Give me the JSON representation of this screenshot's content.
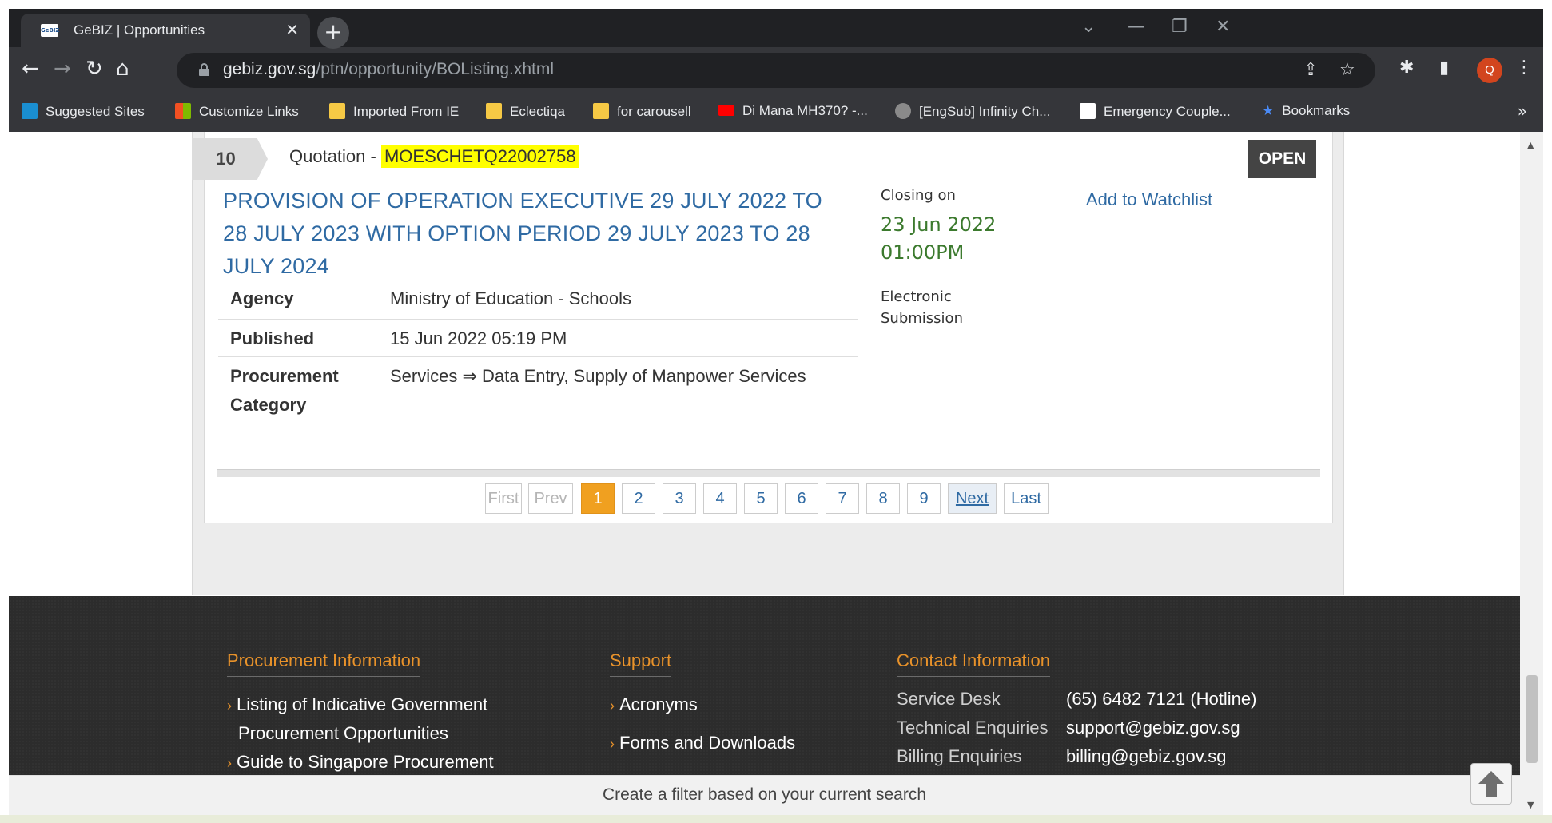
{
  "browser": {
    "tab_title": "GeBIZ | Opportunities",
    "tab_close": "✕",
    "new_tab": "+",
    "url_domain": "gebiz.gov.sg",
    "url_path": "/ptn/opportunity/BOListing.xhtml",
    "profile_initial": "Q",
    "bookmarks": [
      {
        "label": "Suggested Sites",
        "icon": "bing-icon",
        "color": "#1a8ed0"
      },
      {
        "label": "Customize Links",
        "icon": "windows-icon",
        "color": "#f25022"
      },
      {
        "label": "Imported From IE",
        "icon": "folder-icon",
        "color": "#f6c945"
      },
      {
        "label": "Eclectiqa",
        "icon": "folder-icon",
        "color": "#f6c945"
      },
      {
        "label": "for carousell",
        "icon": "folder-icon",
        "color": "#f6c945"
      },
      {
        "label": "Di Mana MH370? -...",
        "icon": "youtube-icon",
        "color": "#ff0000"
      },
      {
        "label": "[EngSub] Infinity Ch...",
        "icon": "globe-icon",
        "color": "#8a8a8a"
      },
      {
        "label": "Emergency Couple...",
        "icon": "df-icon",
        "color": "#ffffff"
      },
      {
        "label": "Bookmarks",
        "icon": "star-icon",
        "color": "#4a8af4"
      }
    ],
    "bookmarks_overflow": "»"
  },
  "listing": {
    "row_number": "10",
    "type_prefix": "Quotation - ",
    "quotation_id": "MOESCHETQ22002758",
    "status": "OPEN",
    "title": "PROVISION OF OPERATION EXECUTIVE 29 JULY 2022 TO 28 JULY 2023 WITH OPTION PERIOD 29 JULY 2023 TO 28 JULY 2024",
    "details": [
      {
        "label": "Agency",
        "value": "Ministry of Education - Schools"
      },
      {
        "label": "Published",
        "value": "15 Jun 2022 05:19 PM"
      },
      {
        "label": "Procurement Category",
        "value": "Services ⇒ Data Entry, Supply of Manpower Services"
      }
    ],
    "closing_label": "Closing on",
    "closing_date": "23 Jun 2022",
    "closing_time": "01:00PM",
    "submission_line1": "Electronic",
    "submission_line2": "Submission",
    "watchlist": "Add to Watchlist"
  },
  "pagination": {
    "first": "First",
    "prev": "Prev",
    "pages": [
      "1",
      "2",
      "3",
      "4",
      "5",
      "6",
      "7",
      "8",
      "9"
    ],
    "current": "1",
    "next": "Next",
    "last": "Last"
  },
  "footer": {
    "procurement_heading": "Procurement Information",
    "procurement_links": [
      "Listing of Indicative Government",
      "Procurement Opportunities",
      "Guide to Singapore Procurement"
    ],
    "support_heading": "Support",
    "support_links": [
      "Acronyms",
      "Forms and Downloads"
    ],
    "contact_heading": "Contact Information",
    "contacts": [
      {
        "label": "Service Desk",
        "value": "(65) 6482 7121 (Hotline)"
      },
      {
        "label": "Technical Enquiries",
        "value": "support@gebiz.gov.sg"
      },
      {
        "label": "Billing Enquiries",
        "value": "billing@gebiz.gov.sg"
      }
    ]
  },
  "filter_bar": "Create a filter based on your current search"
}
